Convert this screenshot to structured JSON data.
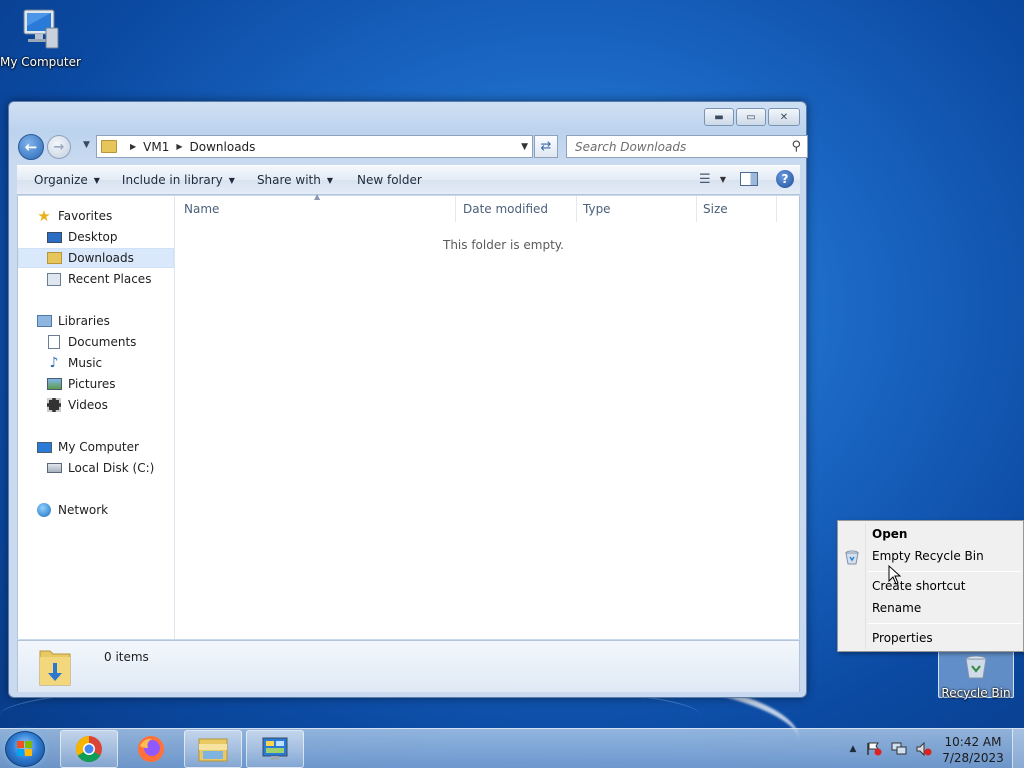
{
  "desktop": {
    "icons": [
      {
        "label": "My Computer",
        "icon": "computer-icon"
      },
      {
        "label": "Recycle Bin",
        "icon": "recycle-bin-icon"
      }
    ]
  },
  "explorer": {
    "window_controls": {
      "minimize": "minimize-icon",
      "maximize": "maximize-icon",
      "close": "close-icon"
    },
    "breadcrumb": [
      "VM1",
      "Downloads"
    ],
    "search": {
      "placeholder": "Search Downloads"
    },
    "toolbar": {
      "organize": "Organize",
      "include_in_library": "Include in library",
      "share_with": "Share with",
      "new_folder": "New folder"
    },
    "nav_pane": {
      "favorites": {
        "label": "Favorites",
        "items": [
          "Desktop",
          "Downloads",
          "Recent Places"
        ]
      },
      "libraries": {
        "label": "Libraries",
        "items": [
          "Documents",
          "Music",
          "Pictures",
          "Videos"
        ]
      },
      "computer": {
        "label": "My Computer",
        "items": [
          "Local Disk (C:)"
        ]
      },
      "network": {
        "label": "Network"
      },
      "selected": "Downloads"
    },
    "columns": [
      "Name",
      "Date modified",
      "Type",
      "Size"
    ],
    "empty_message": "This folder is empty.",
    "details": {
      "item_count": "0 items"
    }
  },
  "context_menu": {
    "items": [
      {
        "label": "Open",
        "bold": true
      },
      {
        "label": "Empty Recycle Bin",
        "icon": "recycle-bin-icon"
      },
      {
        "label": "Create shortcut"
      },
      {
        "label": "Rename"
      },
      {
        "label": "Properties"
      }
    ]
  },
  "taskbar": {
    "pinned": [
      "chrome-icon",
      "firefox-icon",
      "file-explorer-icon",
      "control-panel-icon"
    ],
    "tray_icons": [
      "show-hidden-icons-icon",
      "action-center-flag-icon",
      "network-icon",
      "volume-muted-icon"
    ],
    "clock": {
      "time": "10:42 AM",
      "date": "7/28/2023"
    }
  },
  "colors": {
    "desktop_bg": "#1a66c2",
    "selection": "#d9e8fa",
    "window_frame": "#bcd3ee"
  }
}
